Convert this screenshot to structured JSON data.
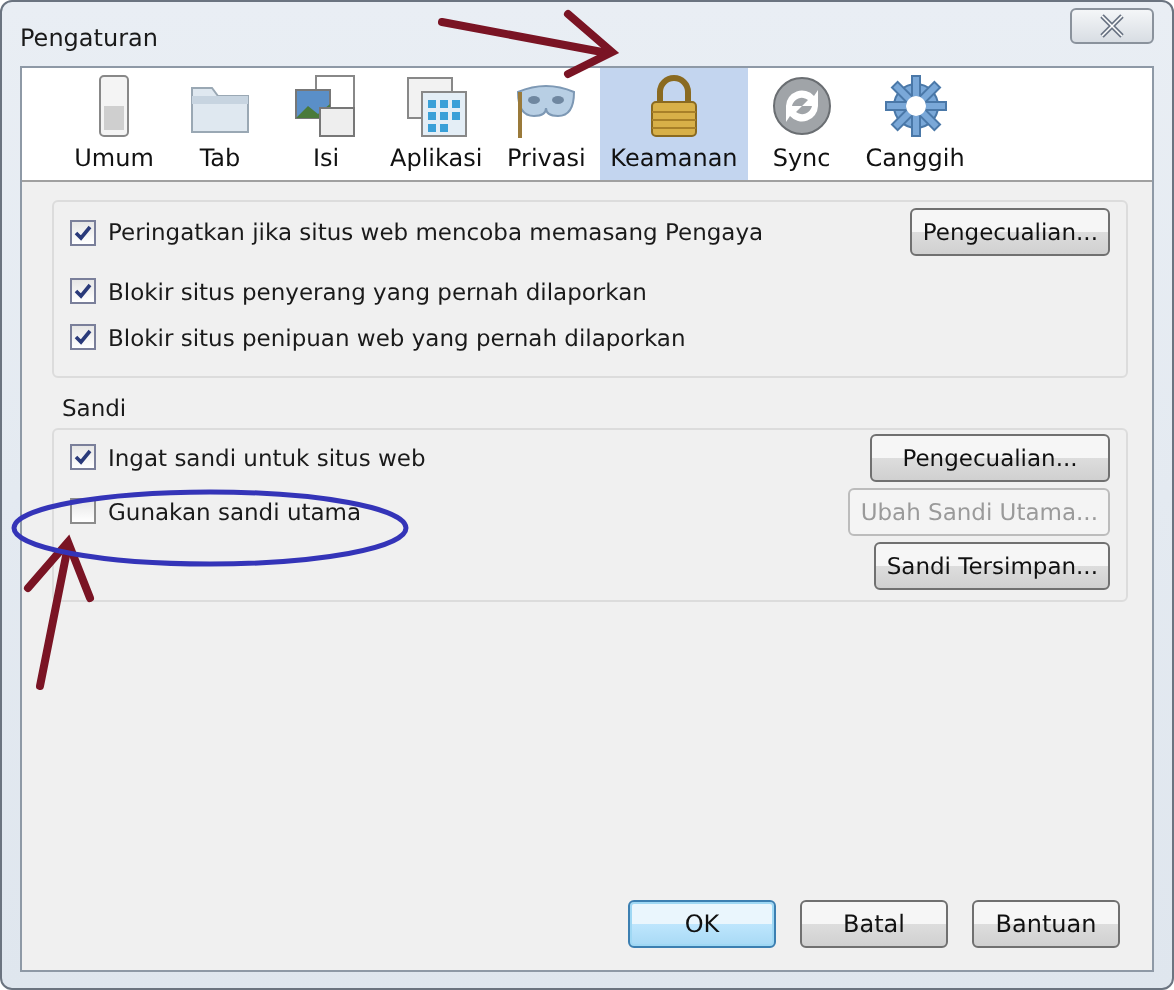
{
  "window": {
    "title": "Pengaturan"
  },
  "tabs": [
    {
      "label": "Umum",
      "selected": false
    },
    {
      "label": "Tab",
      "selected": false
    },
    {
      "label": "Isi",
      "selected": false
    },
    {
      "label": "Aplikasi",
      "selected": false
    },
    {
      "label": "Privasi",
      "selected": false
    },
    {
      "label": "Keamanan",
      "selected": true
    },
    {
      "label": "Sync",
      "selected": false
    },
    {
      "label": "Canggih",
      "selected": false
    }
  ],
  "general": {
    "options": [
      {
        "label": "Peringatkan jika situs web mencoba memasang Pengaya",
        "checked": true,
        "button": {
          "label": "Pengecualian...",
          "disabled": false
        }
      },
      {
        "label": "Blokir situs penyerang yang pernah dilaporkan",
        "checked": true
      },
      {
        "label": "Blokir situs penipuan web yang pernah dilaporkan",
        "checked": true
      }
    ]
  },
  "passwords": {
    "title": "Sandi",
    "options": [
      {
        "label": "Ingat sandi untuk situs web",
        "checked": true,
        "button": {
          "label": "Pengecualian...",
          "disabled": false
        }
      },
      {
        "label": "Gunakan sandi utama",
        "checked": false,
        "button": {
          "label": "Ubah Sandi Utama...",
          "disabled": true
        }
      }
    ],
    "buttons": [
      {
        "label": "Sandi Tersimpan...",
        "disabled": false
      }
    ]
  },
  "footer_buttons": [
    {
      "label": "OK",
      "default": true
    },
    {
      "label": "Batal",
      "default": false
    },
    {
      "label": "Bantuan",
      "default": false
    }
  ]
}
